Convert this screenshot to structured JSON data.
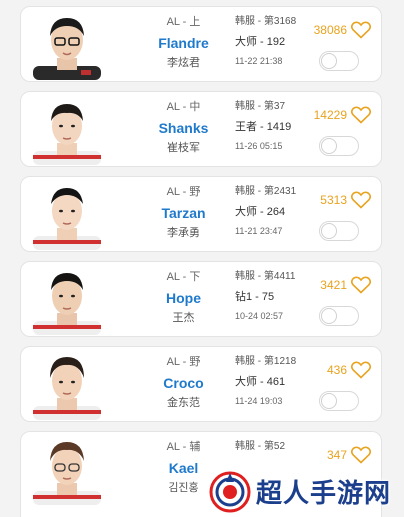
{
  "players": [
    {
      "role": "AL - 上",
      "nickname": "Flandre",
      "real_name": "李炫君",
      "server": "韩服 - 第3168",
      "tier": "大师 - 192",
      "time": "11-22 21:38",
      "likes": "38086",
      "jersey": "dark"
    },
    {
      "role": "AL - 中",
      "nickname": "Shanks",
      "real_name": "崔枝军",
      "server": "韩服 - 第37",
      "tier": "王者 - 1419",
      "time": "11-26 05:15",
      "likes": "14229",
      "jersey": "light"
    },
    {
      "role": "AL - 野",
      "nickname": "Tarzan",
      "real_name": "李承勇",
      "server": "韩服 - 第2431",
      "tier": "大师 - 264",
      "time": "11-21 23:47",
      "likes": "5313",
      "jersey": "light"
    },
    {
      "role": "AL - 下",
      "nickname": "Hope",
      "real_name": "王杰",
      "server": "韩服 - 第4411",
      "tier": "钻1 - 75",
      "time": "10-24 02:57",
      "likes": "3421",
      "jersey": "light"
    },
    {
      "role": "AL - 野",
      "nickname": "Croco",
      "real_name": "金东范",
      "server": "韩服 - 第1218",
      "tier": "大师 - 461",
      "time": "11-24 19:03",
      "likes": "436",
      "jersey": "light"
    },
    {
      "role": "AL - 辅",
      "nickname": "Kael",
      "real_name": "김진홍",
      "server": "韩服 - 第52",
      "tier": "",
      "time": "",
      "likes": "347",
      "jersey": "light"
    }
  ],
  "watermark": {
    "text": "超人手游网"
  },
  "colors": {
    "nickname": "#1f7acc",
    "likes": "#e8a31f",
    "watermark": "#1b3f8c"
  }
}
